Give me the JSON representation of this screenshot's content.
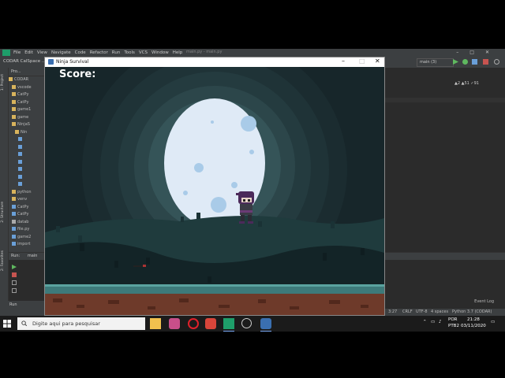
{
  "ide": {
    "menu": [
      "File",
      "Edit",
      "View",
      "Navigate",
      "Code",
      "Refactor",
      "Run",
      "Tools",
      "VCS",
      "Window",
      "Help"
    ],
    "title_tabs": "main.py - main.py",
    "breadcrumb": "CODAR  CalSpace  ...",
    "run_config": "main (3)",
    "project_header": "Pro...",
    "tree": [
      "CODAR",
      "vscode",
      "CatPy",
      "CatPy",
      "game1",
      "game",
      "NinjaS",
      "Nin",
      "",
      "",
      "",
      "",
      "",
      "",
      "",
      "python",
      "venv",
      "CatPy",
      "CatPy",
      "datab",
      "file.py",
      "game2",
      "import"
    ],
    "warnings": "▲2  ▲51  ✓91",
    "run_tab": "Run:",
    "run_config_tab": "main",
    "bottom_tab": "Run",
    "status": {
      "position": "3:27",
      "line_sep": "CRLF",
      "encoding": "UTF-8",
      "indent": "4 spaces",
      "interpreter": "Python 3.7 (CODAR)"
    },
    "event_log": "Event Log",
    "side_labels": {
      "project": "1: Project",
      "structure": "2: Structure",
      "favorites": "2: Favorites"
    }
  },
  "game": {
    "window_title": "Ninja Survival",
    "score_label": "Score:",
    "colors": {
      "sky": "#17262a",
      "moon": "#dfeaf6",
      "crater": "#a9cbe8",
      "hill_back": "#1f3b3d",
      "hill_front": "#132427",
      "ground_top": "#3d7a7a",
      "dirt": "#6e3a2a"
    }
  },
  "taskbar": {
    "search_placeholder": "Digite aqui para pesquisar",
    "lang_top": "POR",
    "lang_bottom": "PTB2",
    "time": "21:28",
    "date": "03/11/2020",
    "apps": [
      "file-explorer",
      "paint",
      "opera",
      "browser",
      "pycharm",
      "game-controller",
      "python"
    ]
  }
}
